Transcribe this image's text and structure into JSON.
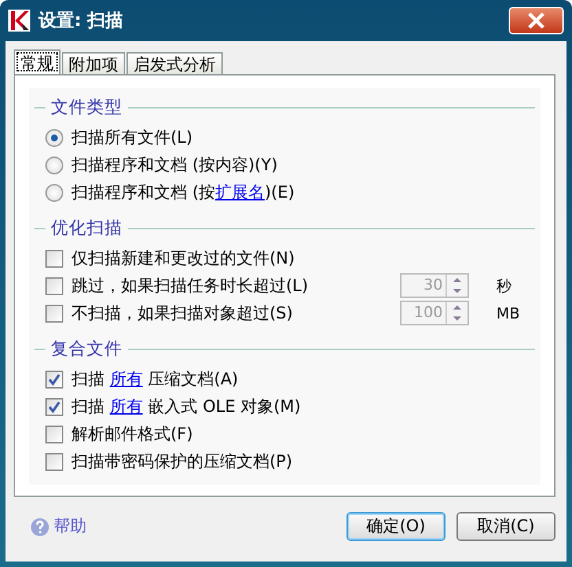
{
  "window": {
    "title": "设置: 扫描"
  },
  "tabs": [
    {
      "label": "常规",
      "selected": true
    },
    {
      "label": "附加项",
      "selected": false
    },
    {
      "label": "启发式分析",
      "selected": false
    }
  ],
  "groups": [
    {
      "title": "文件类型",
      "items": [
        {
          "kind": "radio",
          "selected": true,
          "before": "扫描所有文件(L)"
        },
        {
          "kind": "radio",
          "selected": false,
          "before": "扫描程序和文档 (按内容)(Y)"
        },
        {
          "kind": "radio",
          "selected": false,
          "before": "扫描程序和文档 (按",
          "link": "扩展名",
          "after": ")(E)"
        }
      ]
    },
    {
      "title": "优化扫描",
      "items": [
        {
          "kind": "checkbox",
          "checked": false,
          "before": "仅扫描新建和更改过的文件(N)"
        },
        {
          "kind": "checkbox",
          "checked": false,
          "before": "跳过，如果扫描任务时长超过(L)",
          "spin": {
            "value": "30",
            "disabled": true
          },
          "unit": "秒"
        },
        {
          "kind": "checkbox",
          "checked": false,
          "before": "不扫描，如果扫描对象超过(S)",
          "spin": {
            "value": "100",
            "disabled": true
          },
          "unit": "MB"
        }
      ]
    },
    {
      "title": "复合文件",
      "items": [
        {
          "kind": "checkbox",
          "checked": true,
          "before": "扫描 ",
          "link": "所有",
          "after": " 压缩文档(A)"
        },
        {
          "kind": "checkbox",
          "checked": true,
          "before": "扫描 ",
          "link": "所有",
          "after": " 嵌入式 OLE 对象(M)"
        },
        {
          "kind": "checkbox",
          "checked": false,
          "before": "解析邮件格式(F)"
        },
        {
          "kind": "checkbox",
          "checked": false,
          "before": "扫描带密码保护的压缩文档(P)"
        }
      ]
    }
  ],
  "help": "帮助",
  "buttons": [
    {
      "label": "确定(O)",
      "default": true
    },
    {
      "label": "取消(C)",
      "default": false
    }
  ]
}
